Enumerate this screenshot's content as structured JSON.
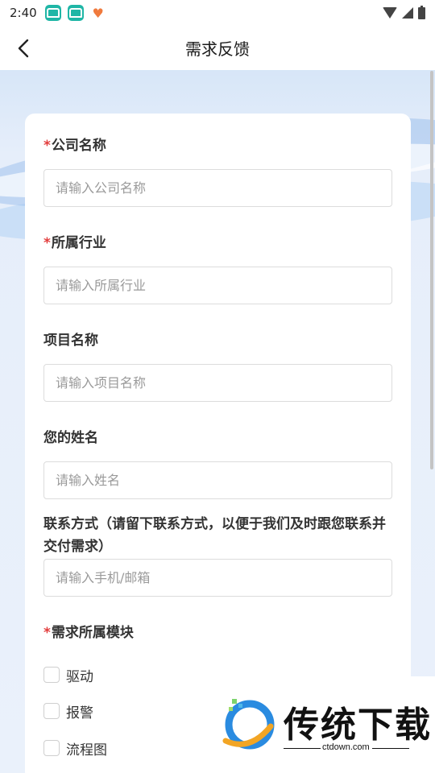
{
  "status_bar": {
    "time": "2:40"
  },
  "header": {
    "title": "需求反馈"
  },
  "form": {
    "company": {
      "required": "*",
      "label": "公司名称",
      "placeholder": "请输入公司名称"
    },
    "industry": {
      "required": "*",
      "label": "所属行业",
      "placeholder": "请输入所属行业"
    },
    "project": {
      "label": "项目名称",
      "placeholder": "请输入项目名称"
    },
    "name": {
      "label": "您的姓名",
      "placeholder": "请输入姓名"
    },
    "contact": {
      "label": "联系方式（请留下联系方式，以便于我们及时跟您联系并交付需求）",
      "placeholder": "请输入手机/邮箱"
    },
    "module": {
      "required": "*",
      "label": "需求所属模块",
      "options": [
        "驱动",
        "报警",
        "流程图"
      ]
    }
  },
  "watermark": {
    "text": "传统下载",
    "url": "ctdown.com"
  },
  "colors": {
    "required": "#e23c3c",
    "background_tint": "#e6eefa"
  }
}
